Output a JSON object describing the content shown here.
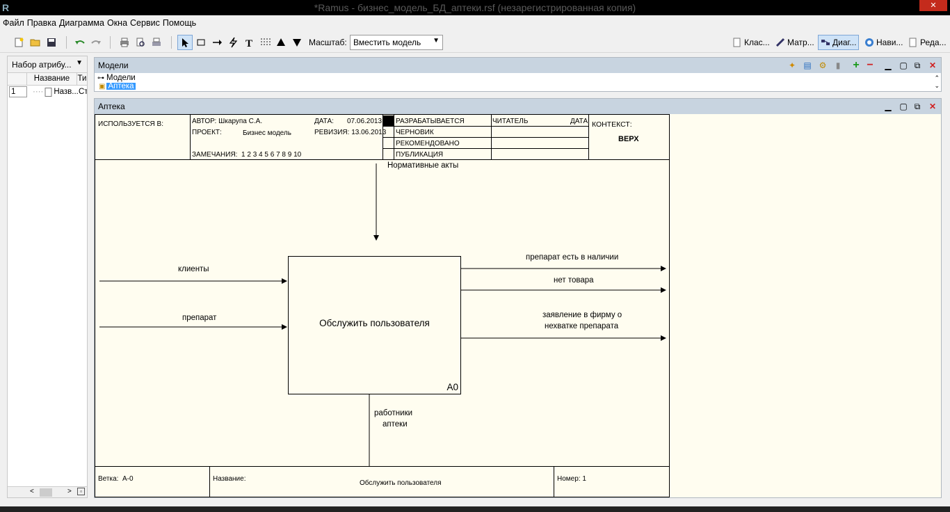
{
  "window": {
    "title": "*Ramus - бизнес_модель_БД_аптеки.rsf (незарегистрированная копия)",
    "close": "✕"
  },
  "menu": [
    "Файл",
    "Правка",
    "Диаграмма",
    "Окна",
    "Сервис",
    "Помощь"
  ],
  "toolbar": {
    "zoom_label": "Масштаб:",
    "zoom_value": "Вместить модель",
    "views": [
      "Клас...",
      "Матр...",
      "Диаг...",
      "Нави...",
      "Реда..."
    ],
    "active_view": 2
  },
  "attributes_panel": {
    "title": "Набор атрибу...",
    "columns": [
      "Название",
      "Ти"
    ],
    "rows": [
      {
        "num": "1",
        "name": "Назв...",
        "type": "Ст"
      }
    ]
  },
  "models_panel": {
    "title": "Модели",
    "tree": [
      {
        "label": "Модели"
      },
      {
        "label": "Аптека"
      }
    ]
  },
  "diagram": {
    "window_title": "Аптека",
    "header": {
      "used_in": "ИСПОЛЬЗУЕТСЯ В:",
      "author_label": "АВТОР:",
      "author": "Шкарупа С.А.",
      "project_label": "ПРОЕКТ:",
      "project": "Бизнес модель",
      "notes_label": "ЗАМЕЧАНИЯ:",
      "notes": "1  2  3  4  5  6  7  8  9  10",
      "date_label": "ДАТА:",
      "date": "07.06.2013",
      "revision_label": "РЕВИЗИЯ:",
      "revision": "13.06.2013",
      "status": [
        "РАЗРАБАТЫВАЕТСЯ",
        "ЧЕРНОВИК",
        "РЕКОМЕНДОВАНО",
        "ПУБЛИКАЦИЯ"
      ],
      "reader_label": "ЧИТАТЕЛЬ",
      "reader_date_label": "ДАТА",
      "context_label": "КОНТЕКСТ:",
      "context": "ВЕРХ"
    },
    "function": {
      "name": "Обслужить пользователя",
      "number": "A0"
    },
    "arrows": {
      "control": "Нормативные акты",
      "input_1": "клиенты",
      "input_2": "препарат",
      "output_1": "препарат есть в наличии",
      "output_2": "нет товара",
      "output_3_line1": "заявление в фирму о",
      "output_3_line2": "нехватке препарата",
      "mechanism_line1": "работники",
      "mechanism_line2": "аптеки"
    },
    "footer": {
      "node_label": "Ветка:",
      "node": "А-0",
      "name_label": "Название:",
      "name": "Обслужить пользователя",
      "number_label": "Номер:",
      "number": "1"
    }
  }
}
